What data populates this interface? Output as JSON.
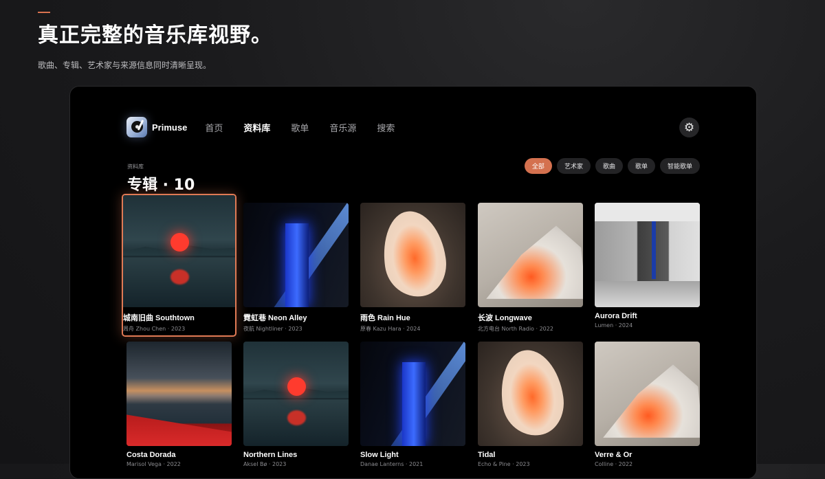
{
  "header": {
    "headline": "真正完整的音乐库视野。",
    "subline": "歌曲、专辑、艺术家与来源信息同时清晰呈现。"
  },
  "app": {
    "brand": "Primuse",
    "nav_tabs": [
      "首页",
      "资料库",
      "歌单",
      "音乐源",
      "搜索"
    ],
    "active_tab": "资料库",
    "settings_icon": "gear-icon",
    "logo_icon": "record-player-icon"
  },
  "library": {
    "section_label": "资料库",
    "title": "专辑 · 10",
    "filters": [
      "全部",
      "艺术家",
      "歌曲",
      "歌单",
      "智能歌单"
    ],
    "active_filter": "全部"
  },
  "albums": [
    {
      "title": "城南旧曲 Southtown",
      "meta": "周舟 Zhou Chen · 2023",
      "art": "sunset"
    },
    {
      "title": "霓虹巷 Neon Alley",
      "meta": "夜航 Nightliner · 2023",
      "art": "neon"
    },
    {
      "title": "雨色 Rain Hue",
      "meta": "原春 Kazu Hara · 2024",
      "art": "petal"
    },
    {
      "title": "长波 Longwave",
      "meta": "北方电台 North Radio · 2022",
      "art": "cloth"
    },
    {
      "title": "Aurora Drift",
      "meta": "Lumen · 2024",
      "art": "aurora"
    },
    {
      "title": "Costa Dorada",
      "meta": "Marisol Vega · 2022",
      "art": "dorada"
    },
    {
      "title": "Northern Lines",
      "meta": "Aksel Bø · 2023",
      "art": "sunset"
    },
    {
      "title": "Slow Light",
      "meta": "Danae Lanterns · 2021",
      "art": "neon"
    },
    {
      "title": "Tidal",
      "meta": "Echo & Pine · 2023",
      "art": "petal"
    },
    {
      "title": "Verre & Or",
      "meta": "Colline · 2022",
      "art": "cloth"
    }
  ],
  "colors": {
    "accent": "#d9724f",
    "background": "#1b1b1d",
    "panel": "#000000",
    "chip": "#232325"
  }
}
